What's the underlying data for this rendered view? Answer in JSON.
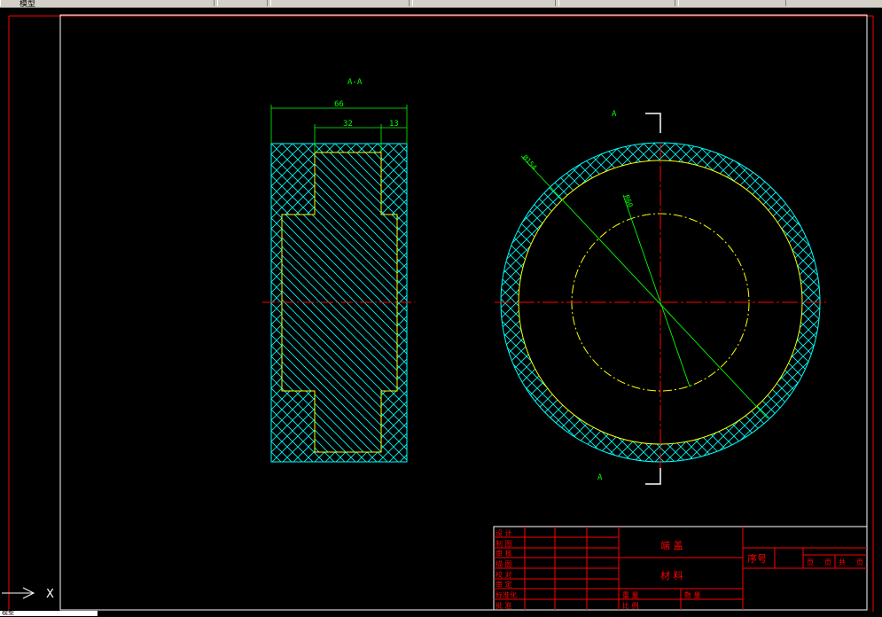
{
  "app": {
    "top_tab_label": "模型",
    "bottom_tab_label": "模型",
    "ucs_axis_label": "X"
  },
  "drawing": {
    "section_label": "A-A",
    "dim_total_width": "66",
    "dim_inner_width": "32",
    "dim_step_width": "13",
    "dim_outer_diameter": "Ø154",
    "dim_inner_radius": "R60",
    "cut_marker_top": "A",
    "cut_marker_bottom": "A",
    "colors": {
      "frame": "#ffffff",
      "border": "#ff0000",
      "hatch": "#00ffff",
      "outline": "#ffff00",
      "centerline": "#ff0000",
      "dimension": "#00ff00"
    }
  },
  "title_block": {
    "part_name": "端  盖",
    "material_label": "材  料",
    "serial_label": "序号",
    "sheet_labels": [
      "页",
      "页",
      "共",
      "页"
    ],
    "left_rows": [
      "设 计",
      "制 图",
      "审 核",
      "描 图",
      "校 对",
      "审 定",
      "标准化",
      "批 准"
    ],
    "bottom_labels": [
      "重  量",
      "数  量",
      "比  例"
    ]
  }
}
